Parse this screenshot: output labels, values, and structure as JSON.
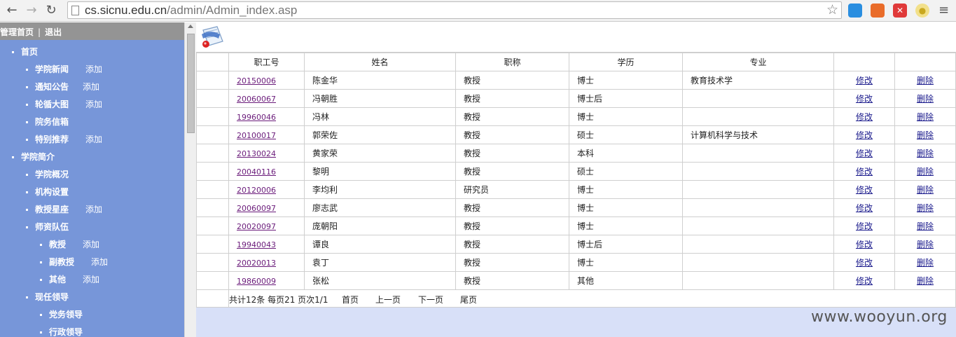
{
  "browser": {
    "url_host": "cs.sicnu.edu.cn",
    "url_path": "/admin/Admin_index.asp"
  },
  "topbar": {
    "home": "管理首页",
    "separator": "|",
    "logout": "退出"
  },
  "sidebar": {
    "items": [
      {
        "label": "首页",
        "add": ""
      },
      {
        "label": "学院新闻",
        "add": "添加"
      },
      {
        "label": "通知公告",
        "add": "添加"
      },
      {
        "label": "轮循大图",
        "add": "添加"
      },
      {
        "label": "院务信箱",
        "add": ""
      },
      {
        "label": "特别推荐",
        "add": "添加"
      },
      {
        "label": "学院简介",
        "add": ""
      },
      {
        "label": "学院概况",
        "add": ""
      },
      {
        "label": "机构设置",
        "add": ""
      },
      {
        "label": "教授星座",
        "add": "添加"
      },
      {
        "label": "师资队伍",
        "add": ""
      },
      {
        "label": "教授",
        "add": "添加"
      },
      {
        "label": "副教授",
        "add": "添加"
      },
      {
        "label": "其他",
        "add": "添加"
      },
      {
        "label": "现任领导",
        "add": ""
      },
      {
        "label": "党务领导",
        "add": ""
      },
      {
        "label": "行政领导",
        "add": ""
      }
    ]
  },
  "table": {
    "headers": [
      "",
      "职工号",
      "姓名",
      "职称",
      "学历",
      "专业",
      "",
      ""
    ],
    "edit_label": "修改",
    "delete_label": "删除",
    "rows": [
      {
        "id": "20150006",
        "name": "陈金华",
        "title": "教授",
        "degree": "博士",
        "major": "教育技术学"
      },
      {
        "id": "20060067",
        "name": "冯朝胜",
        "title": "教授",
        "degree": "博士后",
        "major": ""
      },
      {
        "id": "19960046",
        "name": "冯林",
        "title": "教授",
        "degree": "博士",
        "major": ""
      },
      {
        "id": "20100017",
        "name": "郭荣佐",
        "title": "教授",
        "degree": "硕士",
        "major": "计算机科学与技术"
      },
      {
        "id": "20130024",
        "name": "黄家荣",
        "title": "教授",
        "degree": "本科",
        "major": ""
      },
      {
        "id": "20040116",
        "name": "黎明",
        "title": "教授",
        "degree": "硕士",
        "major": ""
      },
      {
        "id": "20120006",
        "name": "李均利",
        "title": "研究员",
        "degree": "博士",
        "major": ""
      },
      {
        "id": "20060097",
        "name": "廖志武",
        "title": "教授",
        "degree": "博士",
        "major": ""
      },
      {
        "id": "20020097",
        "name": "庞朝阳",
        "title": "教授",
        "degree": "博士",
        "major": ""
      },
      {
        "id": "19940043",
        "name": "谭良",
        "title": "教授",
        "degree": "博士后",
        "major": ""
      },
      {
        "id": "20020013",
        "name": "袁丁",
        "title": "教授",
        "degree": "博士",
        "major": ""
      },
      {
        "id": "19860009",
        "name": "张松",
        "title": "教授",
        "degree": "其他",
        "major": ""
      }
    ]
  },
  "pager": {
    "summary": "共计12条  每页21  页次1/1",
    "first": "首页",
    "prev": "上一页",
    "next": "下一页",
    "last": "尾页"
  },
  "watermark": "www.wooyun.org"
}
